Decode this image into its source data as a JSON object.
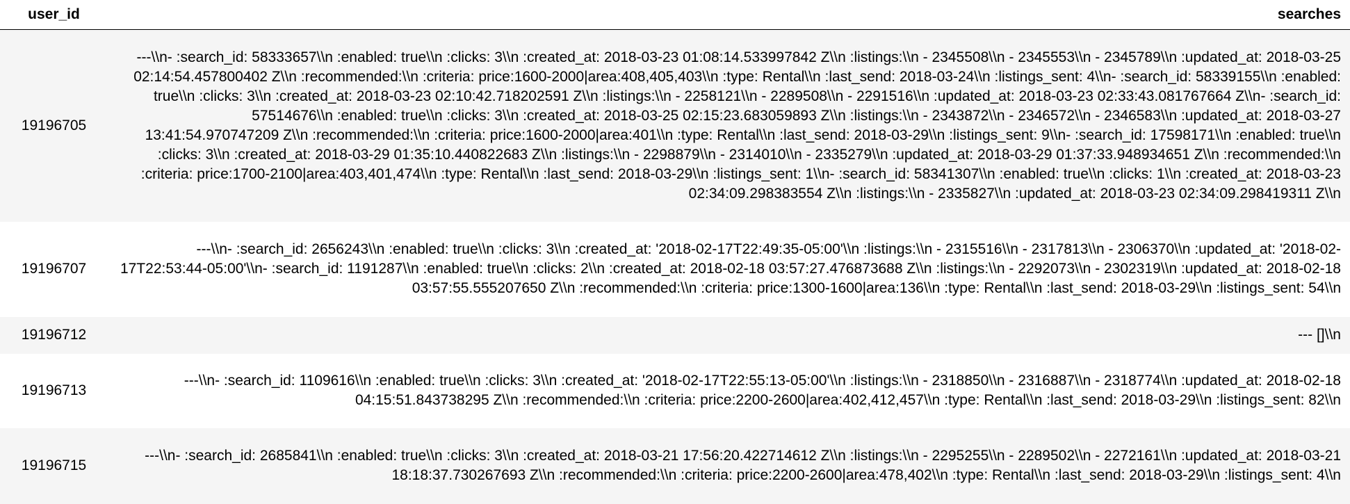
{
  "table": {
    "columns": [
      "user_id",
      "searches"
    ],
    "rows": [
      {
        "user_id": "19196705",
        "searches": "---\\\\n- :search_id: 58333657\\\\n :enabled: true\\\\n :clicks: 3\\\\n :created_at: 2018-03-23 01:08:14.533997842 Z\\\\n :listings:\\\\n - 2345508\\\\n - 2345553\\\\n - 2345789\\\\n :updated_at: 2018-03-25 02:14:54.457800402 Z\\\\n :recommended:\\\\n :criteria: price:1600-2000|area:408,405,403\\\\n :type: Rental\\\\n :last_send: 2018-03-24\\\\n :listings_sent: 4\\\\n- :search_id: 58339155\\\\n :enabled: true\\\\n :clicks: 3\\\\n :created_at: 2018-03-23 02:10:42.718202591 Z\\\\n :listings:\\\\n - 2258121\\\\n - 2289508\\\\n - 2291516\\\\n :updated_at: 2018-03-23 02:33:43.081767664 Z\\\\n- :search_id: 57514676\\\\n :enabled: true\\\\n :clicks: 3\\\\n :created_at: 2018-03-25 02:15:23.683059893 Z\\\\n :listings:\\\\n - 2343872\\\\n - 2346572\\\\n - 2346583\\\\n :updated_at: 2018-03-27 13:41:54.970747209 Z\\\\n :recommended:\\\\n :criteria: price:1600-2000|area:401\\\\n :type: Rental\\\\n :last_send: 2018-03-29\\\\n :listings_sent: 9\\\\n- :search_id: 17598171\\\\n :enabled: true\\\\n :clicks: 3\\\\n :created_at: 2018-03-29 01:35:10.440822683 Z\\\\n :listings:\\\\n - 2298879\\\\n - 2314010\\\\n - 2335279\\\\n :updated_at: 2018-03-29 01:37:33.948934651 Z\\\\n :recommended:\\\\n :criteria: price:1700-2100|area:403,401,474\\\\n :type: Rental\\\\n :last_send: 2018-03-29\\\\n :listings_sent: 1\\\\n- :search_id: 58341307\\\\n :enabled: true\\\\n :clicks: 1\\\\n :created_at: 2018-03-23 02:34:09.298383554 Z\\\\n :listings:\\\\n - 2335827\\\\n :updated_at: 2018-03-23 02:34:09.298419311 Z\\\\n"
      },
      {
        "user_id": "19196707",
        "searches": "---\\\\n- :search_id: 2656243\\\\n :enabled: true\\\\n :clicks: 3\\\\n :created_at: '2018-02-17T22:49:35-05:00'\\\\n :listings:\\\\n - 2315516\\\\n - 2317813\\\\n - 2306370\\\\n :updated_at: '2018-02-17T22:53:44-05:00'\\\\n- :search_id: 1191287\\\\n :enabled: true\\\\n :clicks: 2\\\\n :created_at: 2018-02-18 03:57:27.476873688 Z\\\\n :listings:\\\\n - 2292073\\\\n - 2302319\\\\n :updated_at: 2018-02-18 03:57:55.555207650 Z\\\\n :recommended:\\\\n :criteria: price:1300-1600|area:136\\\\n :type: Rental\\\\n :last_send: 2018-03-29\\\\n :listings_sent: 54\\\\n"
      },
      {
        "user_id": "19196712",
        "searches": "--- []\\\\n"
      },
      {
        "user_id": "19196713",
        "searches": "---\\\\n- :search_id: 1109616\\\\n :enabled: true\\\\n :clicks: 3\\\\n :created_at: '2018-02-17T22:55:13-05:00'\\\\n :listings:\\\\n - 2318850\\\\n - 2316887\\\\n - 2318774\\\\n :updated_at: 2018-02-18 04:15:51.843738295 Z\\\\n :recommended:\\\\n :criteria: price:2200-2600|area:402,412,457\\\\n :type: Rental\\\\n :last_send: 2018-03-29\\\\n :listings_sent: 82\\\\n"
      },
      {
        "user_id": "19196715",
        "searches": "---\\\\n- :search_id: 2685841\\\\n :enabled: true\\\\n :clicks: 3\\\\n :created_at: 2018-03-21 17:56:20.422714612 Z\\\\n :listings:\\\\n - 2295255\\\\n - 2289502\\\\n - 2272161\\\\n :updated_at: 2018-03-21 18:18:37.730267693 Z\\\\n :recommended:\\\\n :criteria: price:2200-2600|area:478,402\\\\n :type: Rental\\\\n :last_send: 2018-03-29\\\\n :listings_sent: 4\\\\n"
      }
    ]
  },
  "colors": {
    "text": "#000000",
    "row_stripe": "#f5f5f5",
    "background": "#ffffff"
  }
}
